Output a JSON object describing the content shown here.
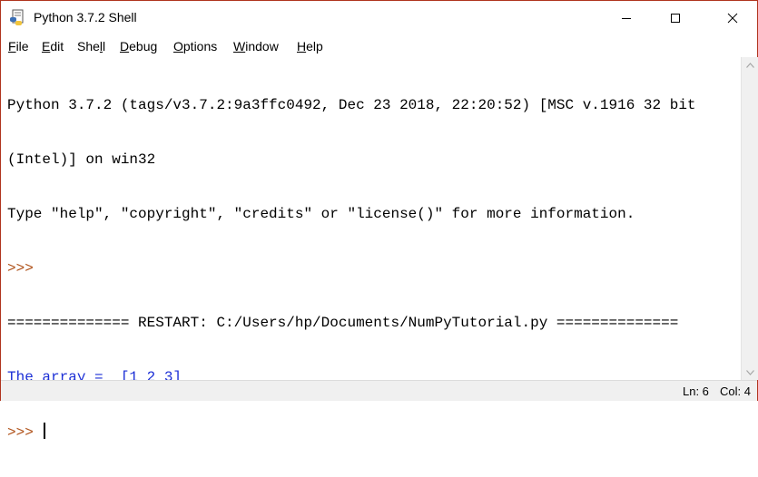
{
  "window": {
    "title": "Python 3.7.2 Shell",
    "accent_border": "#b0341e"
  },
  "icons": {
    "app": "python-idle-icon",
    "minimize": "minimize-icon",
    "maximize": "maximize-icon",
    "close": "close-icon",
    "scroll_up": "chevron-up-icon",
    "scroll_down": "chevron-down-icon"
  },
  "menu": {
    "items": [
      {
        "label": "File",
        "u": "F",
        "rest": "ile"
      },
      {
        "label": "Edit",
        "u": "E",
        "rest": "dit"
      },
      {
        "label": "Shell",
        "pre": "She",
        "u": "l",
        "rest": "l"
      },
      {
        "label": "Debug",
        "u": "D",
        "rest": "ebug"
      },
      {
        "label": "Options",
        "u": "O",
        "rest": "ptions"
      },
      {
        "label": "Window",
        "u": "W",
        "rest": "indow"
      },
      {
        "label": "Help",
        "u": "H",
        "rest": "elp"
      }
    ]
  },
  "shell": {
    "banner_line1": "Python 3.7.2 (tags/v3.7.2:9a3ffc0492, Dec 23 2018, 22:20:52) [MSC v.1916 32 bit",
    "banner_line2": "(Intel)] on win32",
    "banner_line3": "Type \"help\", \"copyright\", \"credits\" or \"license()\" for more information.",
    "prompt": ">>> ",
    "restart_line": "============== RESTART: C:/Users/hp/Documents/NumPyTutorial.py ==============",
    "output_line": "The array =  [1 2 3]",
    "colors": {
      "prompt": "#b0521a",
      "stdout": "#1c2fd6",
      "text": "#000000"
    }
  },
  "status": {
    "ln": "Ln: 6",
    "col": "Col: 4"
  }
}
